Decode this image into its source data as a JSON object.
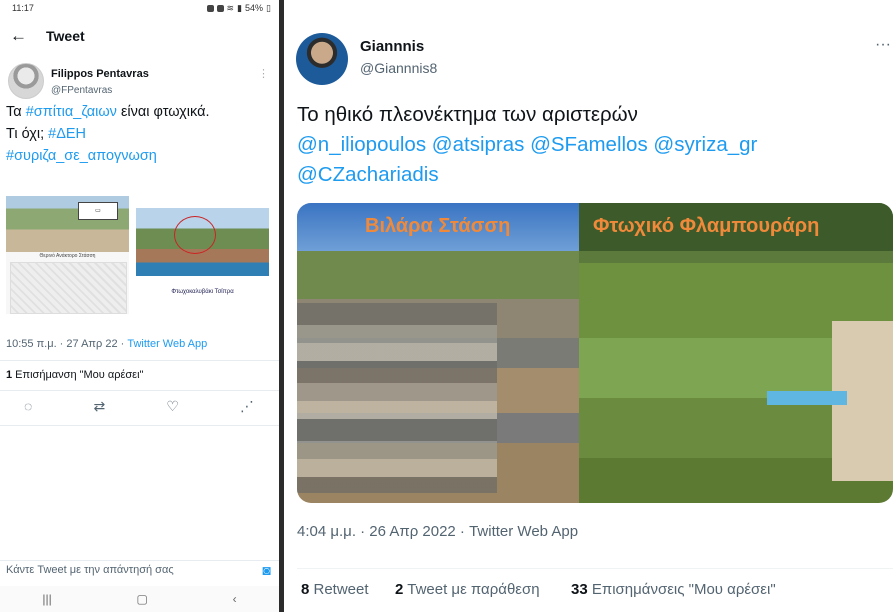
{
  "left": {
    "status": {
      "time": "11:17",
      "battery": "54%"
    },
    "topbar": {
      "title": "Tweet"
    },
    "author": {
      "name": "Filippos Pentavras",
      "handle": "@FPentavras"
    },
    "tweet": {
      "p1": "Τα ",
      "hashtag1": "#σπίτια_ζαιων",
      "p2": " είναι φτωχικά.",
      "p3": "Τι όχι; ",
      "hashtag2": "#ΔΕΗ",
      "hashtag3": "#συριζα_σε_απογνωση"
    },
    "images": {
      "caption1": "Θερινό Ανάκτορο Στάσση",
      "caption2": "Φτωχοκαλυβάκι Τσίπρα"
    },
    "meta": {
      "time": "10:55 π.μ. · 27 Απρ 22 · ",
      "source": "Twitter Web App"
    },
    "likes": {
      "count": "1",
      "label": " Επισήμανση \"Μου αρέσει\""
    },
    "reply_placeholder": "Κάντε Tweet με την απάντησή σας",
    "icons": [
      "reply-icon",
      "retweet-icon",
      "like-icon",
      "share-icon",
      "camera-icon"
    ]
  },
  "right": {
    "author": {
      "name": "Giannnis",
      "handle": "@Giannnis8"
    },
    "tweet": {
      "text": "Το ηθικό πλεονέκτημα των αριστερών",
      "mentions1": "@n_iliopoulos @atsipras @SFamellos @syriza_gr",
      "mentions2": "@CZachariadis"
    },
    "image": {
      "label_left": "Βιλάρα Στάσση",
      "label_right": "Φτωχικό Φλαμπουράρη"
    },
    "meta": "4:04 μ.μ. · 26 Απρ 2022 · Twitter Web App",
    "stats": {
      "retweets_count": "8",
      "retweets_label": " Retweet",
      "quotes_count": "2",
      "quotes_label": " Tweet με παράθεση",
      "likes_count": "33",
      "likes_label": " Επισημάνσεις \"Μου αρέσει\""
    }
  },
  "colors": {
    "link": "#1d9bf0",
    "divider": "#2b2b2b"
  }
}
